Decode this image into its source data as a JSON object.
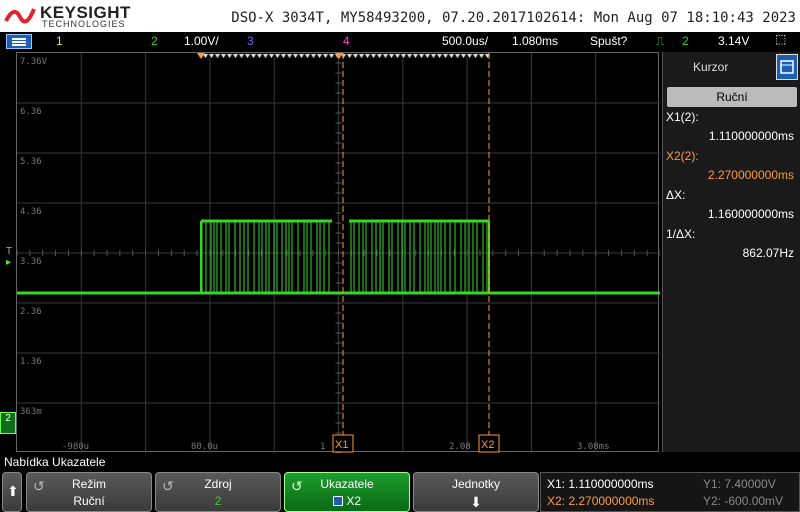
{
  "header": {
    "brand": "KEYSIGHT",
    "brand_sub": "TECHNOLOGIES",
    "scope_id": "DSO-X 3034T, MY58493200, 07.20.2017102614: Mon Aug 07 18:10:43 2023"
  },
  "status": {
    "ch1": "1",
    "ch2": "2",
    "ch2_scale": "1.00V/",
    "ch3": "3",
    "ch4": "4",
    "timebase": "500.0us/",
    "delay": "1.080ms",
    "run_state": "Spušt?",
    "trig_source": "2",
    "trig_level": "3.14V"
  },
  "graticule": {
    "y_labels": [
      "7.36V",
      "6.36",
      "5.36",
      "4.36",
      "3.36",
      "2.36",
      "1.36",
      "363m"
    ],
    "x_labels": [
      "-980u",
      "80.0u",
      "1",
      "2.08",
      "3.08ms"
    ],
    "trig_marker": "T",
    "cursor_x1_label": "X1",
    "cursor_x2_label": "X2",
    "ch2_marker": "2"
  },
  "cursor_panel": {
    "title": "Kurzor",
    "mode": "Ruční",
    "x1_label": "X1(2):",
    "x1_value": "1.110000000ms",
    "x2_label": "X2(2):",
    "x2_value": "2.270000000ms",
    "dx_label": "ΔX:",
    "dx_value": "1.160000000ms",
    "inv_dx_label": "1/ΔX:",
    "inv_dx_value": "862.07Hz"
  },
  "menu": {
    "title": "Nabídka Ukazatele",
    "softkeys": [
      {
        "label": "Režim",
        "value": "Ruční"
      },
      {
        "label": "Zdroj",
        "value": "2"
      },
      {
        "label": "Ukazatele",
        "value": "X2"
      },
      {
        "label": "Jednotky",
        "value": ""
      }
    ],
    "readout": {
      "x1": "X1:  1.110000000ms",
      "x2": "X2:  2.270000000ms",
      "y1": "Y1: 7.40000V",
      "y2": "Y2: -600.00mV"
    }
  },
  "colors": {
    "ch1": "#f4e300",
    "ch2": "#38d62b",
    "ch3": "#4f7dff",
    "ch4": "#ff3fd2",
    "cursor": "#ff9a3a",
    "trigger": "#5ee63b"
  }
}
